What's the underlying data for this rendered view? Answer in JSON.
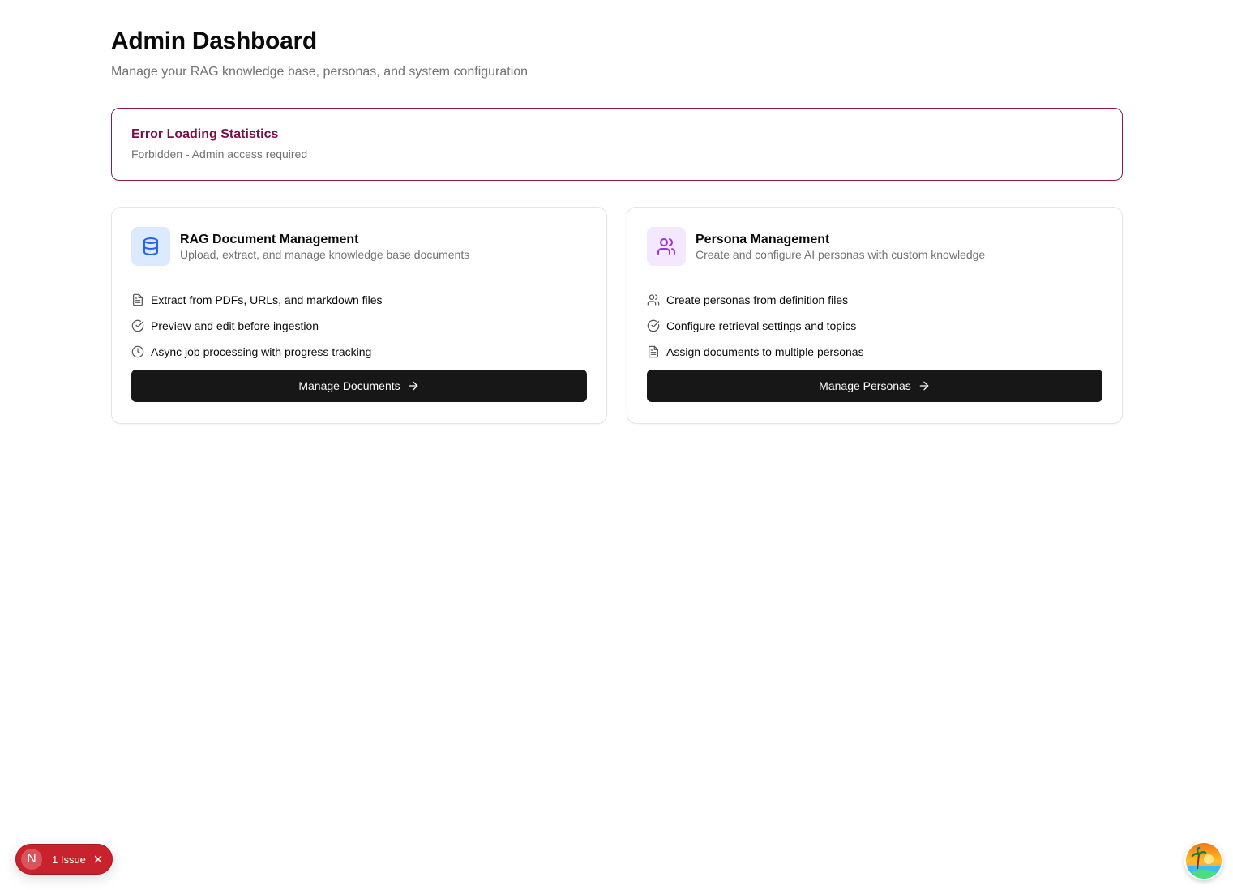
{
  "header": {
    "title": "Admin Dashboard",
    "subtitle": "Manage your RAG knowledge base, personas, and system configuration"
  },
  "error": {
    "title": "Error Loading Statistics",
    "message": "Forbidden - Admin access required"
  },
  "cards": [
    {
      "icon": "database-icon",
      "title": "RAG Document Management",
      "description": "Upload, extract, and manage knowledge base documents",
      "features": [
        {
          "icon": "file-icon",
          "label": "Extract from PDFs, URLs, and markdown files"
        },
        {
          "icon": "check-circle-icon",
          "label": "Preview and edit before ingestion"
        },
        {
          "icon": "clock-icon",
          "label": "Async job processing with progress tracking"
        }
      ],
      "button_label": "Manage Documents"
    },
    {
      "icon": "users-icon",
      "title": "Persona Management",
      "description": "Create and configure AI personas with custom knowledge",
      "features": [
        {
          "icon": "users-icon",
          "label": "Create personas from definition files"
        },
        {
          "icon": "check-circle-icon",
          "label": "Configure retrieval settings and topics"
        },
        {
          "icon": "file-icon",
          "label": "Assign documents to multiple personas"
        }
      ],
      "button_label": "Manage Personas"
    }
  ],
  "dev_overlay": {
    "logo_letter": "N",
    "issues_label": "1 Issue"
  },
  "colors": {
    "error_border": "#8b1a4e",
    "error_title": "#7a0f46",
    "button_bg": "#171717",
    "doc_icon_bg": "#dbeafe",
    "doc_icon": "#2563eb",
    "persona_icon_bg": "#f3e8ff",
    "persona_icon": "#9333ea",
    "issue_badge": "#c8232c"
  }
}
